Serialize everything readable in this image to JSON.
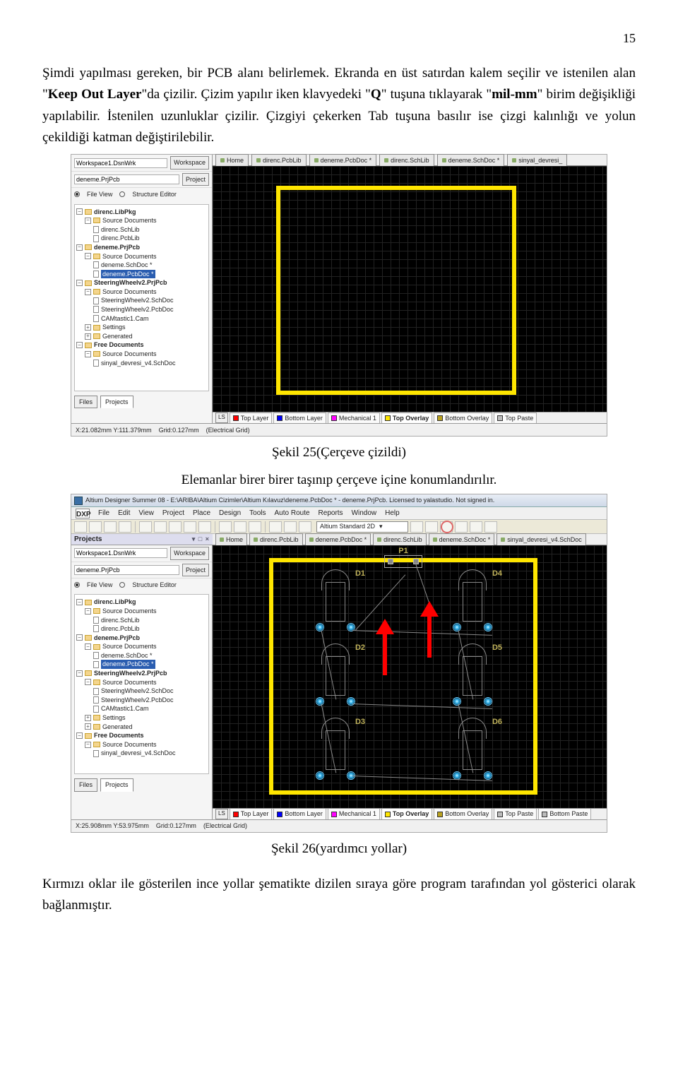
{
  "page_number": "15",
  "para1_a": "Şimdi yapılması gereken, bir PCB alanı belirlemek. Ekranda en üst satırdan kalem seçilir ve istenilen alan \"",
  "para1_kw1": "Keep Out Layer",
  "para1_b": "\"da çizilir. Çizim yapılır iken klavyedeki \"",
  "para1_kw2": "Q",
  "para1_c": "\" tuşuna tıklayarak \"",
  "para1_kw3": "mil-mm",
  "para1_d": "\" birim değişikliği yapılabilir. İstenilen uzunluklar çizilir. Çizgiyi çekerken Tab tuşuna basılır ise çizgi kalınlığı ve yolun çekildiği katman değiştirilebilir.",
  "caption25": "Şekil 25(Çerçeve çizildi)",
  "para2": "Elemanlar birer birer taşınıp çerçeve içine konumlandırılır.",
  "caption26": "Şekil 26(yardımcı yollar)",
  "para3": "Kırmızı oklar ile gösterilen ince yollar şematikte dizilen sıraya göre program tarafından yol gösterici olarak bağlanmıştır.",
  "shared": {
    "workspace": "Workspace1.DsnWrk",
    "workspace_btn": "Workspace",
    "project": "deneme.PrjPcb",
    "project_btn": "Project",
    "file_view": "File View",
    "structure_editor": "Structure Editor",
    "side_tab_files": "Files",
    "side_tab_projects": "Projects",
    "home": "Home",
    "ls_label": "LS"
  },
  "tree": {
    "direnc_libpkg": "direnc.LibPkg",
    "source_docs": "Source Documents",
    "direnc_schlib": "direnc.SchLib",
    "direnc_pcblib": "direnc.PcbLib",
    "deneme_prj": "deneme.PrjPcb",
    "deneme_schdoc": "deneme.SchDoc *",
    "deneme_pcbdoc": "deneme.PcbDoc *",
    "steering_prj": "SteeringWheelv2.PrjPcb",
    "steering_sch": "SteeringWheelv2.SchDoc",
    "steering_pcb": "SteeringWheelv2.PcbDoc",
    "camtastic": "CAMtastic1.Cam",
    "settings": "Settings",
    "generated": "Generated",
    "free_docs": "Free Documents",
    "sinyal": "sinyal_devresi_v4.SchDoc"
  },
  "tabs": {
    "direnc_pcblib": "direnc.PcbLib",
    "deneme_pcbdoc": "deneme.PcbDoc *",
    "direnc_schlib": "direnc.SchLib",
    "deneme_schdoc": "deneme.SchDoc *",
    "sinyal": "sinyal_devresi_"
  },
  "layers": {
    "top": "Top Layer",
    "bottom": "Bottom Layer",
    "mech": "Mechanical 1",
    "top_overlay": "Top Overlay",
    "bot_overlay": "Bottom Overlay",
    "top_paste": "Top Paste",
    "bot_paste": "Bottom Paste"
  },
  "fig25": {
    "status_xy": "X:21.082mm Y:111.379mm",
    "status_grid": "Grid:0.127mm",
    "status_mode": "(Electrical Grid)"
  },
  "fig26": {
    "title": "Altium Designer Summer 08 - E:\\ARIBA\\Altium Cizimler\\Altium Kılavuz\\deneme.PcbDoc * - deneme.PrjPcb. Licensed to yalastudio. Not signed in.",
    "dxp": "DXP",
    "menu": [
      "File",
      "Edit",
      "View",
      "Project",
      "Place",
      "Design",
      "Tools",
      "Auto Route",
      "Reports",
      "Window",
      "Help"
    ],
    "view_combo": "Altium Standard 2D",
    "panel_title": "Projects",
    "status_xy": "X:25.908mm Y:53.975mm",
    "status_grid": "Grid:0.127mm",
    "status_mode": "(Electrical Grid)",
    "components": {
      "P1": "P1",
      "D1": "D1",
      "D2": "D2",
      "D3": "D3",
      "D4": "D4",
      "D5": "D5",
      "D6": "D6"
    },
    "sinyal_tab": "sinyal_devresi_v4.SchDoc"
  }
}
